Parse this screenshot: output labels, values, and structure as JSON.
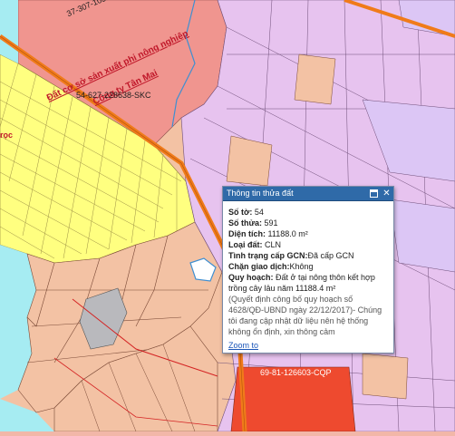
{
  "map": {
    "labels": {
      "parcel_top": "37-307-103275-S",
      "land_owner_1": "Đất cơ sở sản xuất phi nông nghiệp",
      "land_owner_2": "Công ty Tân Mai",
      "parcel_mid": "54-627-228638-SKC",
      "road_fragment": "rọc",
      "parcel_bottom": "69-81-126603-CQP"
    },
    "colors": {
      "residential": "#ffff80",
      "agri": "#f3c2a4",
      "pink": "#ef9ea0",
      "salmon": "#f0958f",
      "purple": "#e7c3ef",
      "lavender": "#dcc6f5",
      "water": "#a6ecf2",
      "gray": "#b9b9bd",
      "orange_road": "#f07b1a",
      "red_area": "#ee4a2f"
    }
  },
  "popup": {
    "title": "Thông tin thửa đất",
    "fields": {
      "so_to_label": "Số tờ:",
      "so_to_value": "54",
      "so_thua_label": "Số thửa:",
      "so_thua_value": "591",
      "dien_tich_label": "Diện tích:",
      "dien_tich_value": "11188.0 m²",
      "loai_dat_label": "Loại đất:",
      "loai_dat_value": "CLN",
      "tinh_trang_label": "Tình trạng cấp GCN:",
      "tinh_trang_value": "Đã cấp GCN",
      "chan_gd_label": "Chặn giao dịch:",
      "chan_gd_value": "Không",
      "quy_hoach_label": "Quy hoạch:",
      "quy_hoach_value": "Đất ở tại nông thôn kết hợp trồng cây lâu năm 11188.4 m²",
      "note": "(Quyết định công bố quy hoạch số 4628/QĐ-UBND ngày 22/12/2017)- Chúng tôi đang cập nhật dữ liệu nên hệ thống không ổn định, xin thông cảm"
    },
    "zoom_link": "Zoom to"
  }
}
